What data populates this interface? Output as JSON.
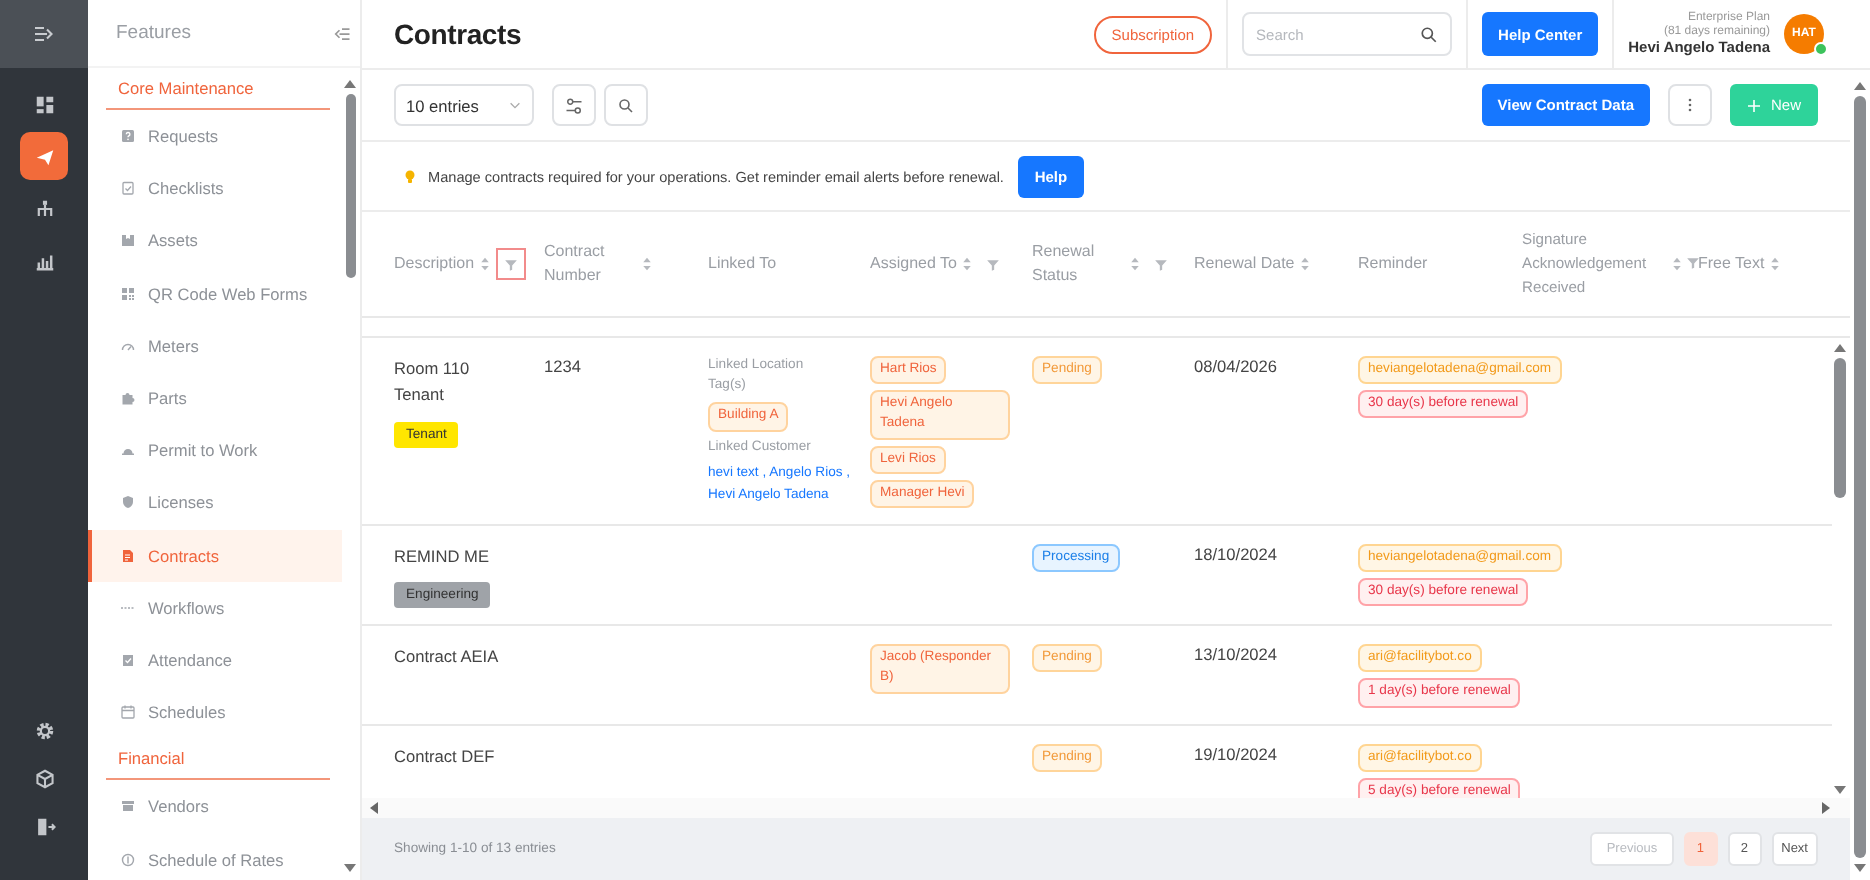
{
  "rail": {
    "items": [
      {
        "selected": false
      },
      {
        "selected": true
      },
      {
        "selected": false
      },
      {
        "selected": false
      }
    ]
  },
  "sidebar": {
    "title": "Features",
    "groups": [
      {
        "heading": "Core Maintenance",
        "items": [
          {
            "label": "Requests",
            "selected": false
          },
          {
            "label": "Checklists",
            "selected": false
          },
          {
            "label": "Assets",
            "selected": false
          },
          {
            "label": "QR Code Web Forms",
            "selected": false
          },
          {
            "label": "Meters",
            "selected": false
          },
          {
            "label": "Parts",
            "selected": false
          },
          {
            "label": "Permit to Work",
            "selected": false
          },
          {
            "label": "Licenses",
            "selected": false
          },
          {
            "label": "Contracts",
            "selected": true
          },
          {
            "label": "Workflows",
            "selected": false
          },
          {
            "label": "Attendance",
            "selected": false
          },
          {
            "label": "Schedules",
            "selected": false
          }
        ]
      },
      {
        "heading": "Financial",
        "items": [
          {
            "label": "Vendors",
            "selected": false
          },
          {
            "label": "Schedule of Rates",
            "selected": false
          }
        ]
      }
    ]
  },
  "topbar": {
    "title": "Contracts",
    "subscription": "Subscription",
    "search": {
      "placeholder": "Search"
    },
    "help_center": "Help Center",
    "plan": "Enterprise Plan",
    "plan_remaining": "(81 days remaining)",
    "user_name": "Hevi Angelo Tadena",
    "avatar": {
      "initials": "HAT",
      "online": true
    }
  },
  "toolbar": {
    "entries": "10 entries",
    "view_data": "View Contract Data",
    "new": "New"
  },
  "notice": {
    "text": "Manage contracts required for your operations. Get reminder email alerts before renewal.",
    "button": "Help"
  },
  "table": {
    "columns": [
      {
        "label": "Description",
        "sortable": true,
        "filterable": true,
        "filter_active": true
      },
      {
        "label": "Contract Number",
        "sortable": true,
        "filterable": false,
        "filter_active": false
      },
      {
        "label": "Linked To",
        "sortable": false,
        "filterable": false,
        "filter_active": false
      },
      {
        "label": "Assigned To",
        "sortable": true,
        "filterable": true,
        "filter_active": false
      },
      {
        "label": "Renewal Status",
        "sortable": true,
        "filterable": true,
        "filter_active": false
      },
      {
        "label": "Renewal Date",
        "sortable": true,
        "filterable": false,
        "filter_active": false
      },
      {
        "label": "Reminder",
        "sortable": false,
        "filterable": false,
        "filter_active": false
      },
      {
        "label": "Signature Acknowledgement Received",
        "sortable": true,
        "filterable": true,
        "filter_active": false
      },
      {
        "label": "Free Text",
        "sortable": true,
        "filterable": false,
        "filter_active": false
      }
    ],
    "rows": [
      {
        "description": "Room 110 Tenant",
        "tag": {
          "label": "Tenant",
          "color": "#ffe600"
        },
        "contract_number": "1234",
        "linked": {
          "location_heading": "Linked Location Tag(s)",
          "location_tags": [
            "Building A"
          ],
          "customer_heading": "Linked Customer",
          "customers": [
            "hevi text",
            "Angelo Rios",
            "Hevi Angelo Tadena"
          ],
          "separator": ","
        },
        "assigned": [
          "Hart Rios",
          "Hevi Angelo Tadena",
          "Levi Rios",
          "Manager Hevi"
        ],
        "status": {
          "label": "Pending",
          "kind": "pending"
        },
        "renewal_date": "08/04/2026",
        "reminder": {
          "email": "heviangelotadena@gmail.com",
          "schedules": [
            "30 day(s) before renewal"
          ]
        }
      },
      {
        "description": "REMIND ME",
        "tag": {
          "label": "Engineering",
          "color": "#9fa3a8"
        },
        "status": {
          "label": "Processing",
          "kind": "processing"
        },
        "renewal_date": "18/10/2024",
        "reminder": {
          "email": "heviangelotadena@gmail.com",
          "schedules": [
            "30 day(s) before renewal"
          ]
        }
      },
      {
        "description": "Contract AEIA",
        "assigned": [
          "Jacob (Responder B)"
        ],
        "status": {
          "label": "Pending",
          "kind": "pending"
        },
        "renewal_date": "13/10/2024",
        "reminder": {
          "email": "ari@facilitybot.co",
          "schedules": [
            "1 day(s) before renewal"
          ]
        }
      },
      {
        "description": "Contract DEF",
        "status": {
          "label": "Pending",
          "kind": "pending"
        },
        "renewal_date": "19/10/2024",
        "reminder": {
          "email": "ari@facilitybot.co",
          "schedules": [
            "5 day(s) before renewal"
          ]
        }
      }
    ]
  },
  "footer": {
    "summary": "Showing 1-10 of 13 entries",
    "pagination": {
      "previous": {
        "label": "Previous",
        "disabled": true
      },
      "pages": [
        {
          "label": "1",
          "selected": true
        },
        {
          "label": "2",
          "selected": false
        }
      ],
      "next": {
        "label": "Next",
        "disabled": false
      }
    }
  }
}
